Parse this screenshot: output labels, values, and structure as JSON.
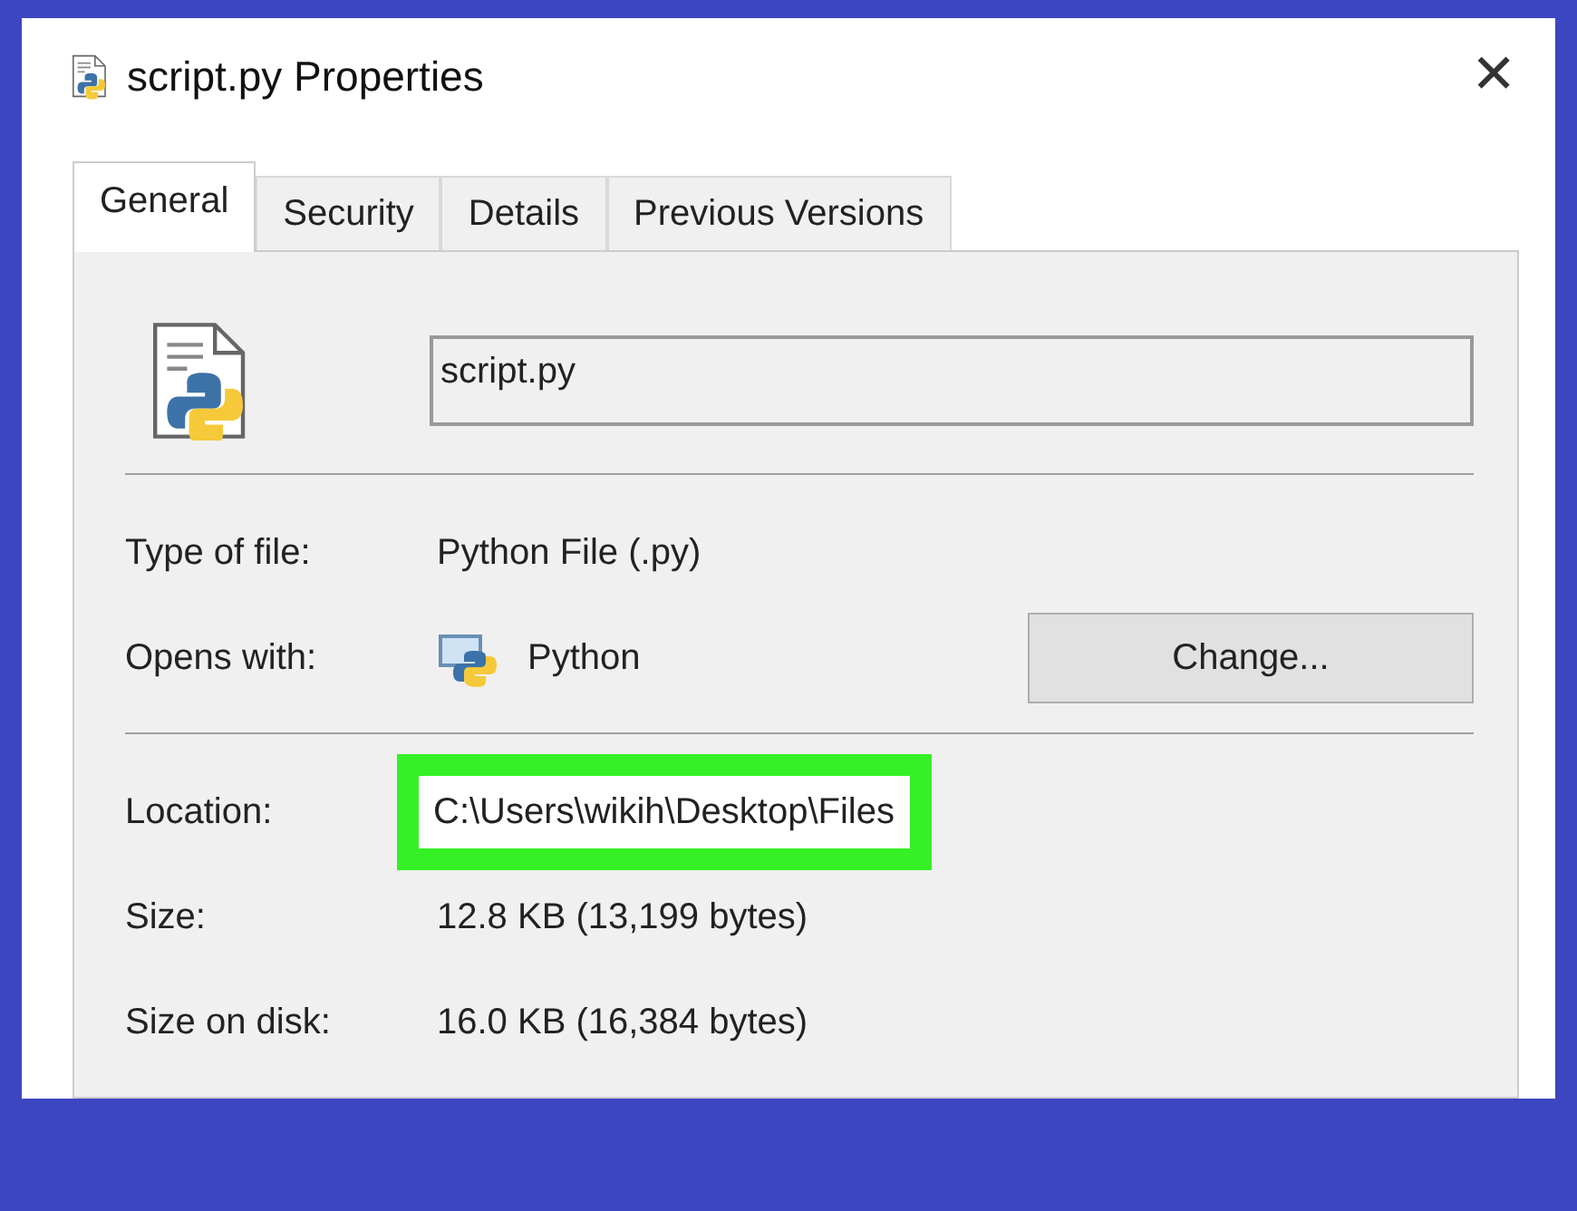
{
  "window": {
    "title": "script.py Properties",
    "close": "✕"
  },
  "tabs": [
    {
      "label": "General",
      "selected": true
    },
    {
      "label": "Security",
      "selected": false
    },
    {
      "label": "Details",
      "selected": false
    },
    {
      "label": "Previous Versions",
      "selected": false
    }
  ],
  "file_name": {
    "value": "script.py"
  },
  "sections": [
    [
      {
        "kind": "text",
        "label": "Type of file:",
        "value": "Python File (.py)",
        "highlighted": false
      },
      {
        "kind": "app",
        "label": "Opens with:",
        "value": "Python",
        "button": "Change...",
        "highlighted": false
      }
    ],
    [
      {
        "kind": "text",
        "label": "Location:",
        "value": "C:\\Users\\wikih\\Desktop\\Files",
        "highlighted": true
      },
      {
        "kind": "text",
        "label": "Size:",
        "value": "12.8 KB (13,199 bytes)",
        "highlighted": false
      },
      {
        "kind": "text",
        "label": "Size on disk:",
        "value": "16.0 KB (16,384 bytes)",
        "highlighted": false
      }
    ]
  ]
}
